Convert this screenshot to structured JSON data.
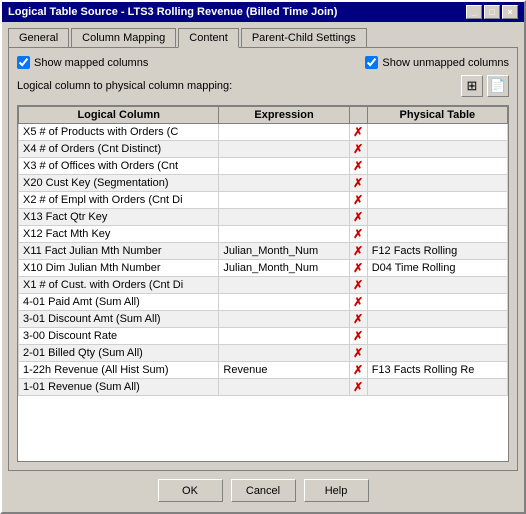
{
  "window": {
    "title": "Logical Table Source - LTS3 Rolling Revenue (Billed Time Join)",
    "title_buttons": [
      "_",
      "□",
      "×"
    ]
  },
  "tabs": [
    {
      "label": "General",
      "active": false
    },
    {
      "label": "Column Mapping",
      "active": false
    },
    {
      "label": "Content",
      "active": true
    },
    {
      "label": "Parent-Child Settings",
      "active": false
    }
  ],
  "options": {
    "show_mapped": "Show mapped columns",
    "show_unmapped": "Show unmapped columns"
  },
  "icons": {
    "icon1": "📋",
    "icon2": "📄"
  },
  "mapping_label": "Logical column to physical column mapping:",
  "columns": {
    "logical": "Logical Column",
    "expression": "Expression",
    "physical": "Physical Table"
  },
  "rows": [
    {
      "logical": "X5  # of Products with Orders  (C",
      "expression": "",
      "has_x": true,
      "physical": ""
    },
    {
      "logical": "X4  # of Orders  (Cnt Distinct)",
      "expression": "",
      "has_x": true,
      "physical": ""
    },
    {
      "logical": "X3  # of Offices with Orders  (Cnt",
      "expression": "",
      "has_x": true,
      "physical": ""
    },
    {
      "logical": "X20  Cust Key (Segmentation)",
      "expression": "",
      "has_x": true,
      "physical": ""
    },
    {
      "logical": "X2  # of Empl with Orders  (Cnt Di",
      "expression": "",
      "has_x": true,
      "physical": ""
    },
    {
      "logical": "X13  Fact Qtr Key",
      "expression": "",
      "has_x": true,
      "physical": ""
    },
    {
      "logical": "X12  Fact Mth Key",
      "expression": "",
      "has_x": true,
      "physical": ""
    },
    {
      "logical": "X11  Fact Julian Mth Number",
      "expression": "Julian_Month_Num",
      "has_x": true,
      "physical": "F12 Facts Rolling"
    },
    {
      "logical": "X10  Dim Julian Mth Number",
      "expression": "Julian_Month_Num",
      "has_x": true,
      "physical": "D04 Time Rolling"
    },
    {
      "logical": "X1  # of Cust. with Orders  (Cnt Di",
      "expression": "",
      "has_x": true,
      "physical": ""
    },
    {
      "logical": "4-01  Paid Amt  (Sum All)",
      "expression": "",
      "has_x": true,
      "physical": ""
    },
    {
      "logical": "3-01  Discount Amt  (Sum All)",
      "expression": "",
      "has_x": true,
      "physical": ""
    },
    {
      "logical": "3-00  Discount Rate",
      "expression": "",
      "has_x": true,
      "physical": ""
    },
    {
      "logical": "2-01  Billed Qty  (Sum All)",
      "expression": "",
      "has_x": true,
      "physical": ""
    },
    {
      "logical": "1-22h  Revenue  (All Hist Sum)",
      "expression": "Revenue",
      "has_x": true,
      "physical": "F13 Facts Rolling Re"
    },
    {
      "logical": "1-01  Revenue  (Sum All)",
      "expression": "",
      "has_x": true,
      "physical": ""
    }
  ],
  "buttons": {
    "ok": "OK",
    "cancel": "Cancel",
    "help": "Help"
  }
}
